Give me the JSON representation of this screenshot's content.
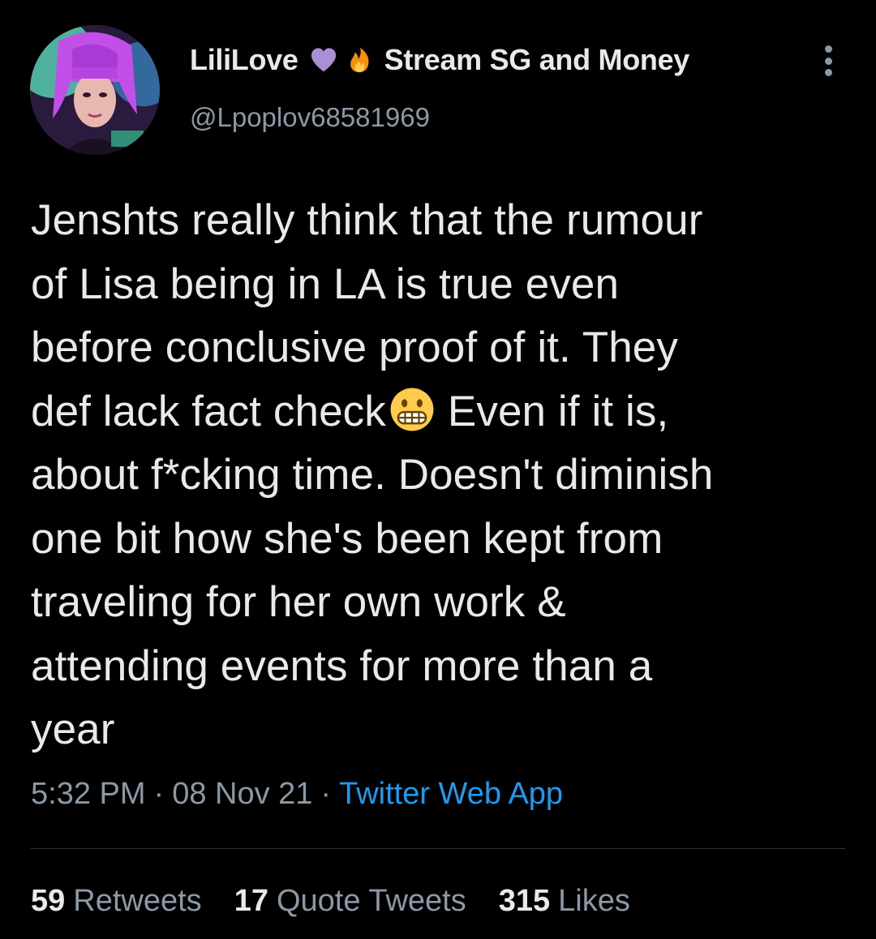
{
  "user": {
    "display_name": "LiliLove",
    "display_name_suffix": "Stream SG and Money",
    "handle": "@Lpoplov68581969",
    "name_emojis": [
      "purple-heart",
      "fire"
    ]
  },
  "tweet": {
    "lines": [
      "Jenshts really think that the rumour",
      "of Lisa being in LA is true even",
      "before conclusive proof of it. They",
      "def lack fact check",
      "Even if it is,",
      "about f*cking time. Doesn't diminish",
      "one bit how she's been kept from",
      "traveling for her own work &",
      "attending events for more than a",
      "year"
    ],
    "inline_emoji": "grimacing-face"
  },
  "meta": {
    "time": "5:32 PM",
    "separator": "·",
    "date": "08 Nov 21",
    "source": "Twitter Web App"
  },
  "stats": {
    "retweets_count": "59",
    "retweets_label": "Retweets",
    "quotes_count": "17",
    "quotes_label": "Quote Tweets",
    "likes_count": "315",
    "likes_label": "Likes"
  },
  "colors": {
    "background": "#000000",
    "text": "#e7e9ea",
    "secondary": "#8b98a5",
    "link": "#1d9bf0",
    "divider": "#2f3336"
  }
}
